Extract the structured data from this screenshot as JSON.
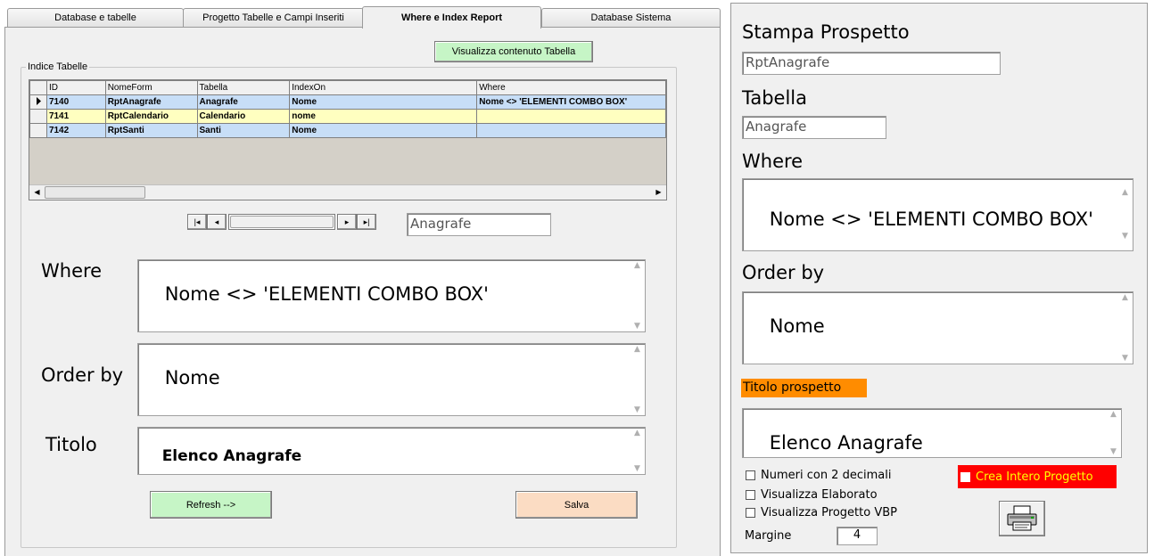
{
  "tabs": [
    {
      "label": "Database e tabelle"
    },
    {
      "label": "Progetto Tabelle e Campi Inseriti"
    },
    {
      "label": "Where e Index Report",
      "active": true
    },
    {
      "label": "Database Sistema"
    }
  ],
  "main": {
    "view_table_button": "Visualizza contenuto Tabella",
    "group_title": "Indice Tabelle",
    "grid": {
      "columns": [
        "ID",
        "NomeForm",
        "Tabella",
        "IndexOn",
        "Where"
      ],
      "rows": [
        {
          "id": "7140",
          "nome_form": "RptAnagrafe",
          "tabella": "Anagrafe",
          "index_on": "Nome",
          "where": "Nome <> 'ELEMENTI COMBO BOX'",
          "current": true
        },
        {
          "id": "7141",
          "nome_form": "RptCalendario",
          "tabella": "Calendario",
          "index_on": "nome",
          "where": ""
        },
        {
          "id": "7142",
          "nome_form": "RptSanti",
          "tabella": "Santi",
          "index_on": "Nome",
          "where": ""
        }
      ]
    },
    "navigator": {
      "first": "|◂",
      "prev": "◂",
      "next": "▸",
      "last": "▸|"
    },
    "table_name_value": "Anagrafe",
    "where_label": "Where",
    "where_value": "Nome <> 'ELEMENTI COMBO BOX'",
    "order_label": "Order by",
    "order_value": "Nome",
    "title_label": "Titolo",
    "title_value": "Elenco Anagrafe",
    "refresh_button": "Refresh -->",
    "save_button": "Salva"
  },
  "side": {
    "print_label": "Stampa Prospetto",
    "print_value": "RptAnagrafe",
    "table_label": "Tabella",
    "table_value": "Anagrafe",
    "where_label": "Where",
    "where_value": "Nome <> 'ELEMENTI COMBO BOX'",
    "order_label": "Order by",
    "order_value": "Nome",
    "report_title_label": "Titolo prospetto",
    "report_title_value": "Elenco Anagrafe",
    "decimals_label": "Numeri con 2 decimali",
    "show_elaborated_label": "Visualizza Elaborato",
    "show_vbp_label": "Visualizza Progetto VBP",
    "create_project_label": "Crea Intero Progetto",
    "margin_label": "Margine",
    "margin_value": "4"
  },
  "colors": {
    "green_button": "#c6f5c6",
    "peach_button": "#fbdcc3",
    "row_blue": "#c7def7",
    "row_yellow": "#ffffc0",
    "orange_label": "#ff8c00",
    "red_checkbox_bg": "#ff0000",
    "red_checkbox_text": "#ffff00"
  },
  "icons": {
    "printer": "printer-icon",
    "current_row": "row-pointer-icon"
  }
}
